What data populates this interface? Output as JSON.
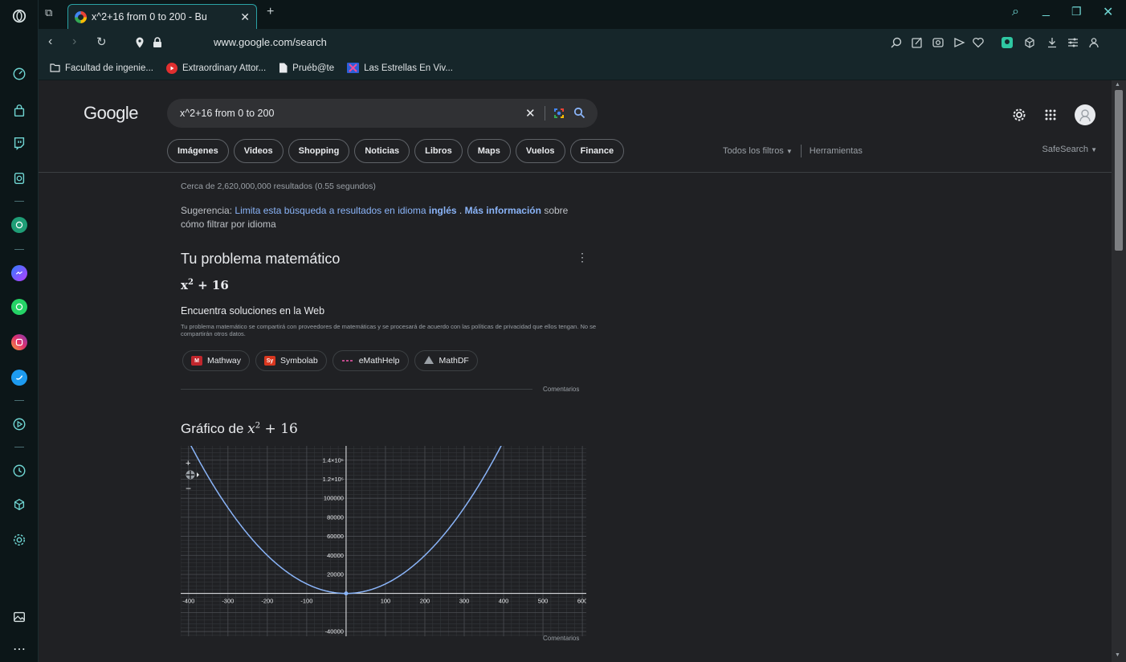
{
  "browser": {
    "tab_title": "x^2+16 from 0 to 200 - Bu",
    "url": "www.google.com/search",
    "bookmarks": [
      {
        "label": "Facultad de ingenie..."
      },
      {
        "label": "Extraordinary Attor..."
      },
      {
        "label": "Pruéb@te"
      },
      {
        "label": "Las Estrellas En Viv..."
      }
    ]
  },
  "google": {
    "logo": "Google",
    "query": "x^2+16 from 0 to 200",
    "chips": [
      "Imágenes",
      "Videos",
      "Shopping",
      "Noticias",
      "Libros",
      "Maps",
      "Vuelos",
      "Finance"
    ],
    "all_filters": "Todos los filtros",
    "tools": "Herramientas",
    "safesearch": "SafeSearch"
  },
  "results": {
    "stats": "Cerca de 2,620,000,000 resultados (0.55 segundos)",
    "suggestion_label": "Sugerencia:",
    "suggestion_link": "Limita esta búsqueda a resultados en idioma",
    "suggestion_lang": "inglés",
    "suggestion_sep": ".",
    "more_info": "Más información",
    "suggestion_tail": "sobre cómo filtrar por idioma"
  },
  "math_problem": {
    "title": "Tu problema matemático",
    "expr_base": "x",
    "expr_exp": "2",
    "expr_rest": " + 16",
    "subtitle": "Encuentra soluciones en la Web",
    "note": "Tu problema matemático se compartirá con proveedores de matemáticas y se procesará de acuerdo con las políticas de privacidad que ellos tengan. No se compartirán otros datos.",
    "solvers": [
      {
        "name": "Mathway",
        "logo_color": "#c1272d"
      },
      {
        "name": "Symbolab",
        "logo_color": "#d9371f"
      },
      {
        "name": "eMathHelp",
        "logo_color": "#c04a8c"
      },
      {
        "name": "MathDF",
        "logo_color": "#9aa0a6"
      }
    ],
    "feedback": "Comentarios"
  },
  "graph_section": {
    "title_prefix": "Gráfico de",
    "feedback": "Comentarios",
    "zoom_in": "+",
    "zoom_out": "−"
  },
  "chart_data": {
    "type": "line",
    "function": "x^2+16",
    "xlim": [
      -420,
      610
    ],
    "ylim": [
      -45000,
      155000
    ],
    "x_ticks": [
      -400,
      -300,
      -200,
      -100,
      100,
      200,
      300,
      400,
      500,
      600
    ],
    "x_tick_labels": [
      "-400",
      "-300",
      "-200",
      "-100",
      "100",
      "200",
      "300",
      "400",
      "500",
      "600"
    ],
    "y_ticks": [
      -40000,
      20000,
      40000,
      60000,
      80000,
      100000,
      120000,
      140000
    ],
    "y_tick_labels": [
      "-40000",
      "20000",
      "40000",
      "60000",
      "80000",
      "100000",
      "1.2×10⁵",
      "1.4×10⁵"
    ],
    "grid": true,
    "line_color": "#8ab4f8"
  },
  "colors": {
    "accent": "#2aa2a5",
    "link": "#8ab4f8",
    "bg": "#202124"
  }
}
